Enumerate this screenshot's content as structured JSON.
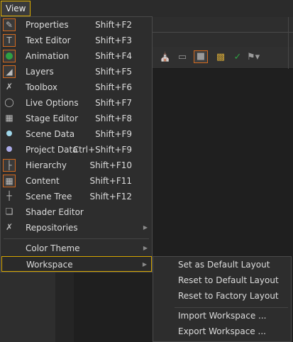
{
  "menubar": {
    "view_label": "View"
  },
  "colors": {
    "accent": "#d36a1f",
    "highlight": "#d4a400",
    "menu_bg": "#2d2d2d"
  },
  "menu": {
    "items": [
      {
        "label": "Properties",
        "shortcut": "Shift+F2",
        "icon": "pencil-icon"
      },
      {
        "label": "Text Editor",
        "shortcut": "Shift+F3",
        "icon": "text-cursor-icon"
      },
      {
        "label": "Animation",
        "shortcut": "Shift+F4",
        "icon": "animation-icon"
      },
      {
        "label": "Layers",
        "shortcut": "Shift+F5",
        "icon": "layers-icon"
      },
      {
        "label": "Toolbox",
        "shortcut": "Shift+F6",
        "icon": "tools-icon"
      },
      {
        "label": "Live Options",
        "shortcut": "Shift+F7",
        "icon": "gauge-icon"
      },
      {
        "label": "Stage Editor",
        "shortcut": "Shift+F8",
        "icon": "stage-grid-icon"
      },
      {
        "label": "Scene Data",
        "shortcut": "Shift+F9",
        "icon": "dot-icon"
      },
      {
        "label": "Project Data",
        "shortcut": "Ctrl+Shift+F9",
        "icon": "dot-icon"
      },
      {
        "label": "Hierarchy",
        "shortcut": "Shift+F10",
        "icon": "hierarchy-icon"
      },
      {
        "label": "Content",
        "shortcut": "Shift+F11",
        "icon": "content-grid-icon"
      },
      {
        "label": "Scene Tree",
        "shortcut": "Shift+F12",
        "icon": "tree-icon"
      },
      {
        "label": "Shader Editor",
        "shortcut": "",
        "icon": "shader-cube-icon"
      },
      {
        "label": "Repositories",
        "shortcut": "",
        "icon": "tools-icon"
      }
    ],
    "color_theme_label": "Color Theme",
    "workspace_label": "Workspace"
  },
  "workspace_submenu": {
    "items": [
      "Set as Default Layout",
      "Reset to Default Layout",
      "Reset to Factory Layout",
      "Import Workspace ...",
      "Export Workspace ..."
    ]
  }
}
